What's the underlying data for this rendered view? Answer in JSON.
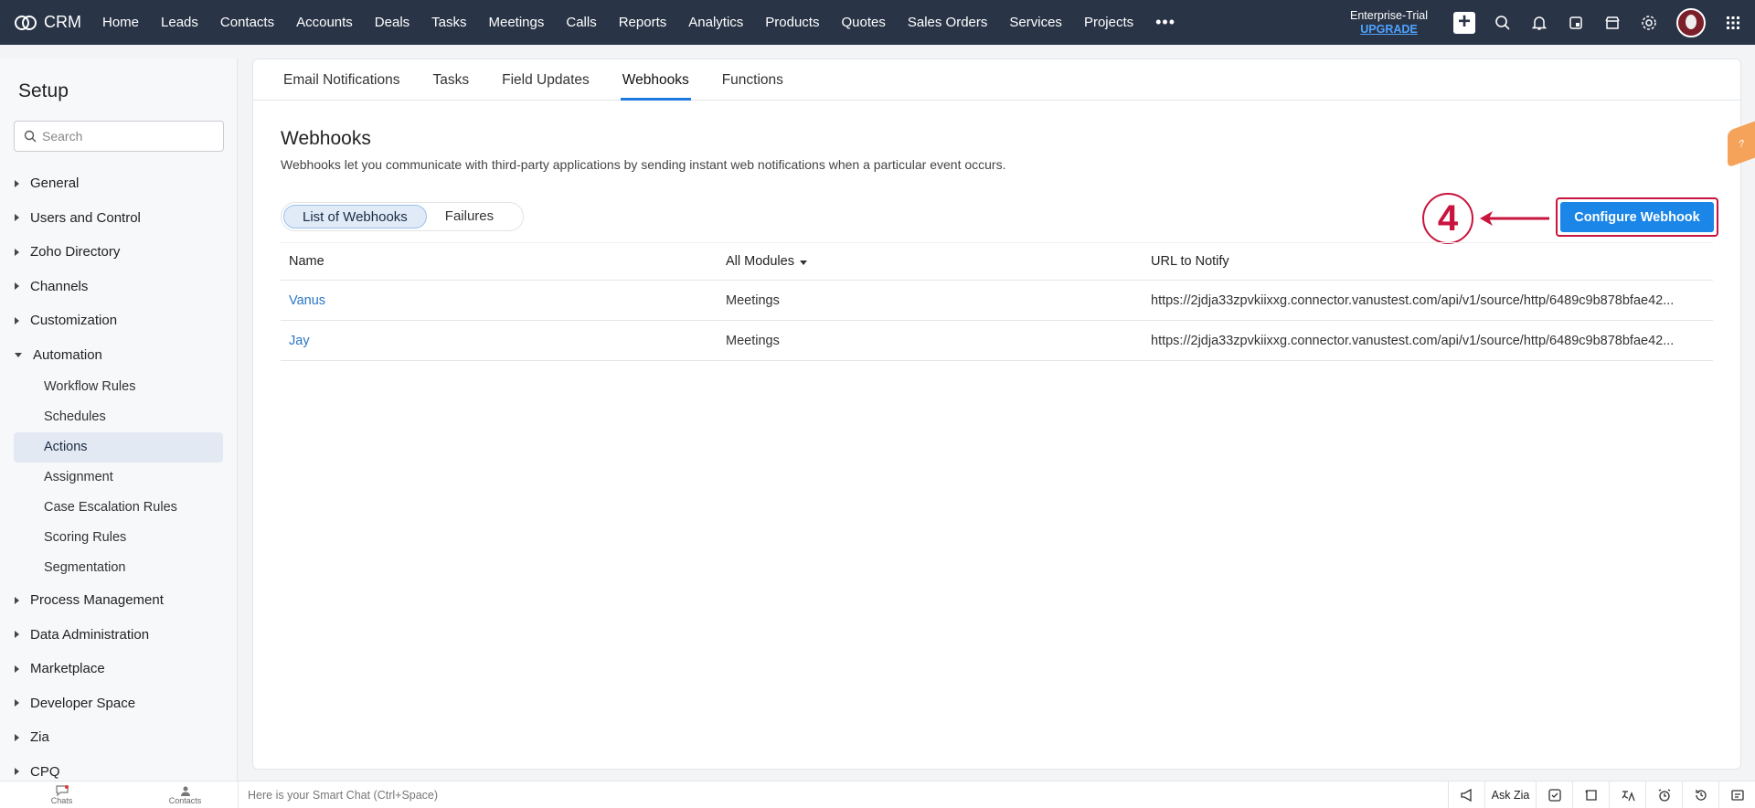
{
  "topbar": {
    "app_name": "CRM",
    "nav": [
      "Home",
      "Leads",
      "Contacts",
      "Accounts",
      "Deals",
      "Tasks",
      "Meetings",
      "Calls",
      "Reports",
      "Analytics",
      "Products",
      "Quotes",
      "Sales Orders",
      "Services",
      "Projects"
    ],
    "more": "•••",
    "plan": "Enterprise-Trial",
    "upgrade": "UPGRADE",
    "plus": "+"
  },
  "sidebar": {
    "title": "Setup",
    "search_placeholder": "Search",
    "sections_before": [
      "General",
      "Users and Control",
      "Zoho Directory",
      "Channels",
      "Customization"
    ],
    "automation": "Automation",
    "automation_items": [
      "Workflow Rules",
      "Schedules",
      "Actions",
      "Assignment",
      "Case Escalation Rules",
      "Scoring Rules",
      "Segmentation"
    ],
    "active_item": "Actions",
    "sections_after": [
      "Process Management",
      "Data Administration",
      "Marketplace",
      "Developer Space",
      "Zia",
      "CPQ"
    ]
  },
  "main": {
    "tabs": [
      "Email Notifications",
      "Tasks",
      "Field Updates",
      "Webhooks",
      "Functions"
    ],
    "active_tab": "Webhooks",
    "title": "Webhooks",
    "description": "Webhooks let you communicate with third-party applications by sending instant web notifications when a particular event occurs.",
    "toggle": [
      "List of Webhooks",
      "Failures"
    ],
    "configure_button": "Configure Webhook",
    "step_number": "4",
    "help": "?",
    "table": {
      "headers": {
        "name": "Name",
        "module": "All Modules",
        "url": "URL to Notify"
      },
      "rows": [
        {
          "name": "Vanus",
          "module": "Meetings",
          "url": "https://2jdja33zpvkiixxg.connector.vanustest.com/api/v1/source/http/6489c9b878bfae42..."
        },
        {
          "name": "Jay",
          "module": "Meetings",
          "url": "https://2jdja33zpvkiixxg.connector.vanustest.com/api/v1/source/http/6489c9b878bfae42..."
        }
      ]
    }
  },
  "bottombar": {
    "chats": "Chats",
    "contacts": "Contacts",
    "smart_chat": "Here is your Smart Chat (Ctrl+Space)",
    "ask_zia": "Ask Zia"
  },
  "colors": {
    "topbar": "#2a3447",
    "accent": "#1b86e8",
    "annotation": "#c8143e",
    "link": "#2a76c4"
  }
}
